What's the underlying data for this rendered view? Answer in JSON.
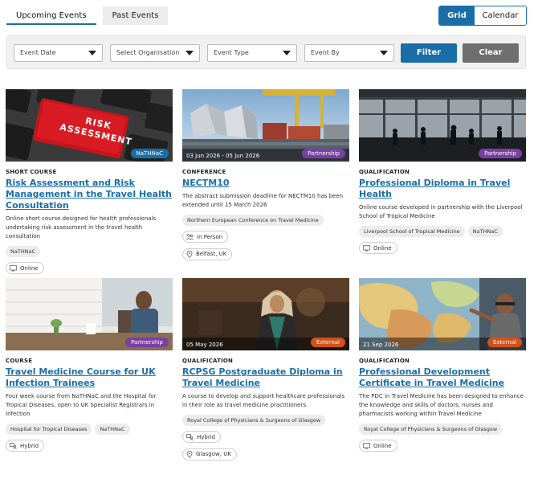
{
  "tabs": [
    {
      "label": "Upcoming Events",
      "active": true
    },
    {
      "label": "Past Events",
      "active": false
    }
  ],
  "view_toggle": {
    "grid_label": "Grid",
    "calendar_label": "Calendar"
  },
  "filters": {
    "event_date": "Event Date",
    "organisation": "Select Organisation",
    "event_type": "Event Type",
    "event_by": "Event By",
    "filter_label": "Filter",
    "clear_label": "Clear"
  },
  "colors": {
    "accent": "#1a6ea8",
    "partnership": "#7b3fa3",
    "external": "#d0521d",
    "clear": "#6e6e6e"
  },
  "cards": [
    {
      "type": "Short Course",
      "title": "Risk Assessment and Risk Management in the Travel Health Consultation",
      "description": "Online short course designed for health professionals undertaking risk assessment in the travel health consultation",
      "badge": "NaTHNaC",
      "date": "",
      "tags": [
        "NaTHNaC"
      ],
      "mode": "Online",
      "location": ""
    },
    {
      "type": "Conference",
      "title": "NECTM10",
      "description": "The abstract submission deadline for NECTM10 has been extended until 15 March 2026",
      "badge": "Partnership",
      "date": "03 Jun 2026 - 05 Jun 2026",
      "tags": [
        "Northern European Conference on Travel Medicine"
      ],
      "mode": "In Person",
      "location": "Belfast, UK"
    },
    {
      "type": "Qualification",
      "title": "Professional Diploma in Travel Health",
      "description": "Online course developed in partnership with the Liverpool School of Tropical Medicine",
      "badge": "Partnership",
      "date": "",
      "tags": [
        "Liverpool School of Tropical Medicine",
        "NaTHNaC"
      ],
      "mode": "Online",
      "location": ""
    },
    {
      "type": "Course",
      "title": "Travel Medicine Course for UK Infection Trainees",
      "description": "Four week course from NaTHNaC and the Hospital for Tropical Diseases, open to UK Specialist Registrars in Infection",
      "badge": "Partnership",
      "date": "",
      "tags": [
        "Hospital for Tropical Diseases",
        "NaTHNaC"
      ],
      "mode": "Hybrid",
      "location": ""
    },
    {
      "type": "Qualification",
      "title": "RCPSG Postgraduate Diploma in Travel Medicine",
      "description": "A course to develop and support healthcare professionals in their role as travel medicine practitioners",
      "badge": "External",
      "date": "05 May 2026",
      "tags": [
        "Royal College of Physicians & Surgeons of Glasgow"
      ],
      "mode": "Hybrid",
      "location": "Glasgow, UK"
    },
    {
      "type": "Qualification",
      "title": "Professional Development Certificate in Travel Medicine",
      "description": "The PDC in Travel Medicine has been designed to enhance the knowledge and skills of doctors, nurses and pharmacists working within Travel Medicine",
      "badge": "External",
      "date": "21 Sep 2026",
      "tags": [
        "Royal College of Physicians & Surgeons of Glasgow"
      ],
      "mode": "Online",
      "location": ""
    }
  ],
  "images": {
    "keyboard_key_line1": "RISK",
    "keyboard_key_line2": "ASSESSMENT"
  }
}
